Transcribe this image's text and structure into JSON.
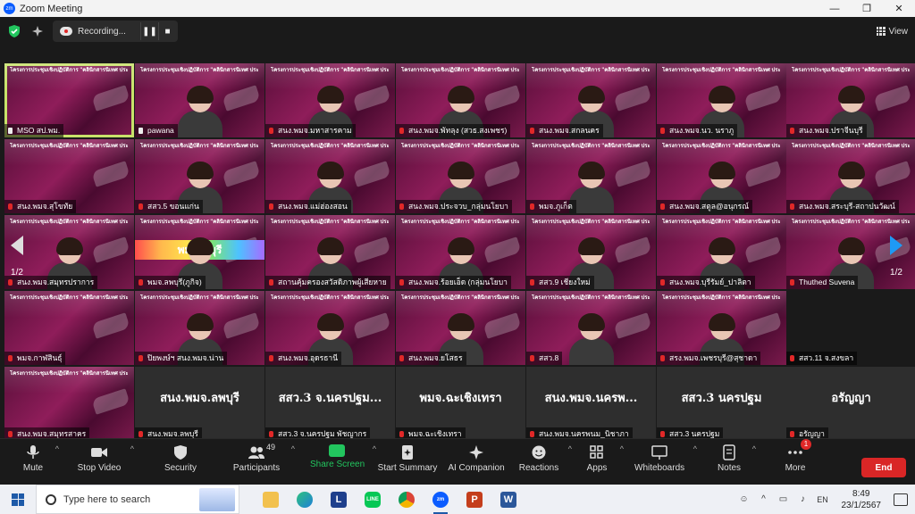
{
  "window": {
    "title": "Zoom Meeting",
    "logo_text": "zm",
    "minimize": "—",
    "maximize": "❐",
    "close": "✕"
  },
  "topbar": {
    "recording_label": "Recording...",
    "pause": "❚❚",
    "stop": "■",
    "view_label": "View"
  },
  "slide_header": "โครงการประชุมเชิงปฏิบัติการ \"คลินิกสารนิเทศ ประจำปี พ.ศ. 2567\" (ครั้งที่ 1)",
  "tiles": [
    {
      "label": "MSO สป.พม.",
      "kind": "video",
      "active": true,
      "pin": true
    },
    {
      "label": "pawana",
      "kind": "video",
      "pin": true
    },
    {
      "label": "สนง.พมจ.มหาสารคาม",
      "kind": "video"
    },
    {
      "label": "สนง.พมจ.พัทลุง (สวธ.สงเพชร)",
      "kind": "video"
    },
    {
      "label": "สนง.พมจ.สกลนคร",
      "kind": "video"
    },
    {
      "label": "สนง.พมจ.นว. นราภู",
      "kind": "video"
    },
    {
      "label": "สนง.พมจ.ปราจีนบุรี",
      "kind": "video"
    },
    {
      "label": "สนง.พมจ.สุโขทัย",
      "kind": "video"
    },
    {
      "label": "สสว.5 ขอนแก่น",
      "kind": "video"
    },
    {
      "label": "สนง.พมจ.แม่ฮ่องสอน",
      "kind": "video"
    },
    {
      "label": "สนง.พมจ.ประจวบ_กลุ่มนโยบา",
      "kind": "video"
    },
    {
      "label": "พมจ.ภูเก็ต",
      "kind": "video"
    },
    {
      "label": "สนง.พมจ.สตูล@อนุกรณ์",
      "kind": "video"
    },
    {
      "label": "สนง.พมจ.สระบุรี-สถาปนวัฒน์",
      "kind": "video"
    },
    {
      "label": "สนง.พมจ.สมุทรปราการ",
      "kind": "video"
    },
    {
      "label": "พมจ.ลพบุรี(ภูกิจ)",
      "kind": "video",
      "banner": "พม.ลพบุรี"
    },
    {
      "label": "สถานคุ้มครองสวัสดิภาพผู้เสียหาย",
      "kind": "video"
    },
    {
      "label": "สนง.พมจ.ร้อยเอ็ด (กลุ่มนโยบา",
      "kind": "video"
    },
    {
      "label": "สสว.9 เชียงใหม่",
      "kind": "video"
    },
    {
      "label": "สนง.พมจ.บุรีรัมย์_ปาลิตา",
      "kind": "video"
    },
    {
      "label": "Thuthed Suvena",
      "kind": "video"
    },
    {
      "label": "พมจ.กาฬสินธุ์",
      "kind": "video"
    },
    {
      "label": "ปิยพงษ์ฯ สนง.พมจ.น่าน",
      "kind": "video"
    },
    {
      "label": "สนง.พมจ.อุดรธานี",
      "kind": "video"
    },
    {
      "label": "สนง.พมจ.ยโสธร",
      "kind": "video"
    },
    {
      "label": "สสว.8",
      "kind": "video"
    },
    {
      "label": "สรง.พมจ.เพชรบุรี@สุชาดา",
      "kind": "video"
    },
    {
      "label": "สสว.11 จ.สงขลา",
      "kind": "empty"
    },
    {
      "label": "สนง.พมจ.สมุทรสาคร",
      "kind": "video"
    },
    {
      "label": "สนง.พมจ.ลพบุรี",
      "kind": "name",
      "bigname": "สนง.พมจ.ลพบุรี"
    },
    {
      "label": "สสว.3 จ.นครปฐม พัชญากร",
      "kind": "name",
      "bigname": "สสว.3 จ.นครปฐม..."
    },
    {
      "label": "พมจ.ฉะเชิงเทรา",
      "kind": "name",
      "bigname": "พมจ.ฉะเชิงเทรา"
    },
    {
      "label": "สนง.พมจ.นครพนม_นิชาภา",
      "kind": "name",
      "bigname": "สนง.พมจ.นครพ..."
    },
    {
      "label": "สสว.3 นครปฐม",
      "kind": "name",
      "bigname": "สสว.3 นครปฐม"
    },
    {
      "label": "อรัญญา",
      "kind": "name",
      "bigname": "อรัญญา"
    }
  ],
  "pager": {
    "left": "1/2",
    "right": "1/2"
  },
  "toolbar": {
    "mute": "Mute",
    "stop_video": "Stop Video",
    "security": "Security",
    "participants": "Participants",
    "participants_count": "49",
    "share_screen": "Share Screen",
    "start_summary": "Start Summary",
    "ai_companion": "AI Companion",
    "reactions": "Reactions",
    "apps": "Apps",
    "whiteboards": "Whiteboards",
    "notes": "Notes",
    "more": "More",
    "more_badge": "1",
    "end": "End"
  },
  "taskbar": {
    "search_placeholder": "Type here to search",
    "lang": "EN",
    "time": "8:49",
    "date": "23/1/2567"
  }
}
